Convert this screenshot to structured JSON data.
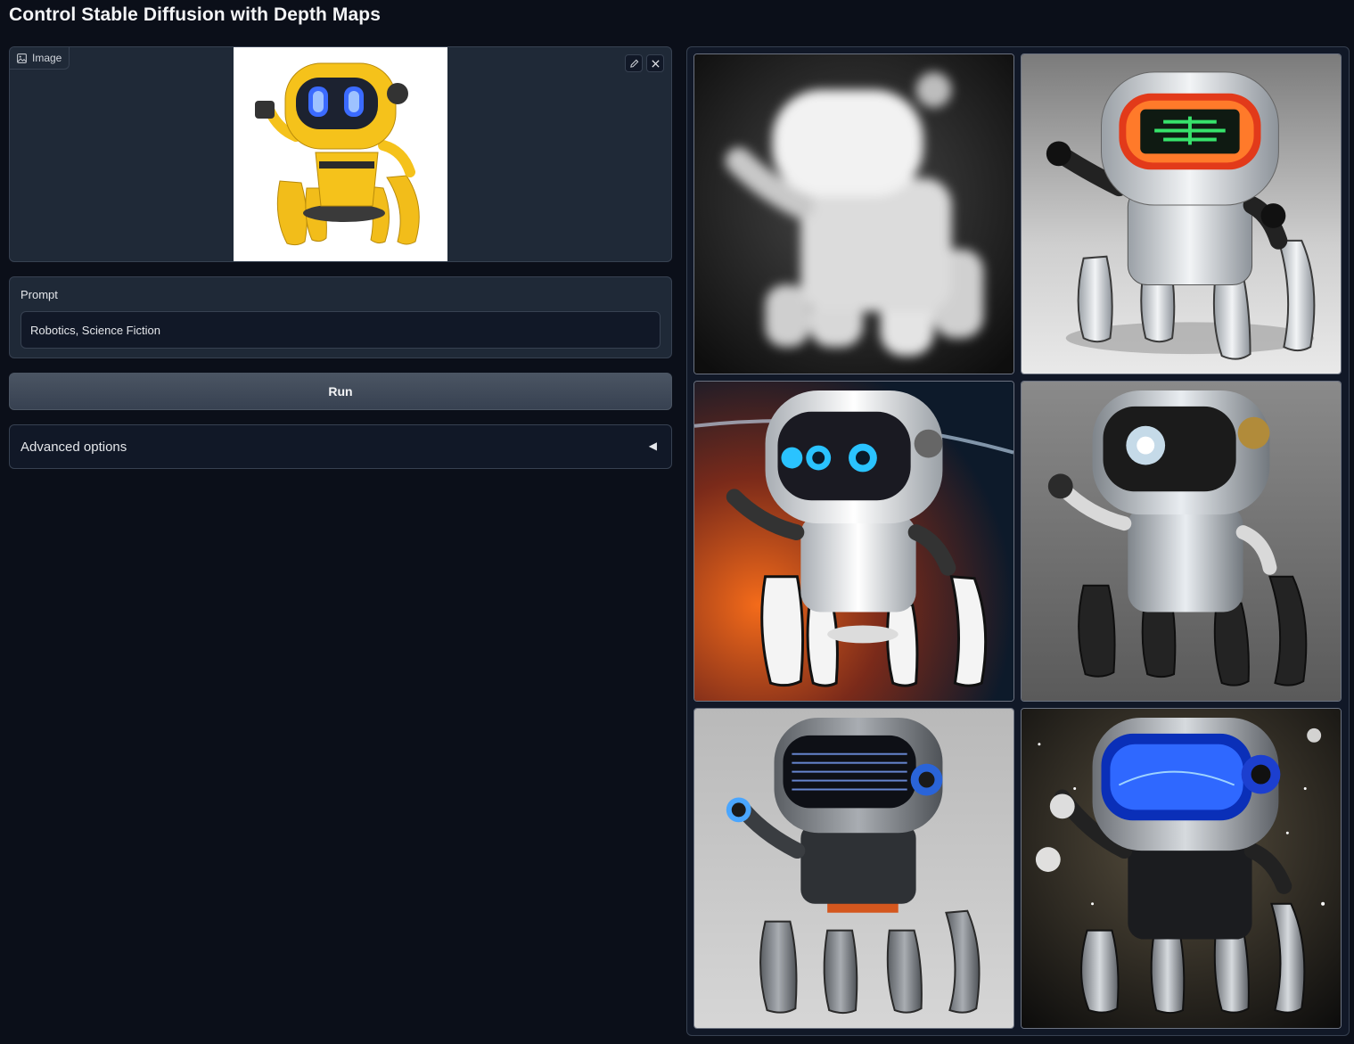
{
  "page": {
    "title": "Control Stable Diffusion with Depth Maps"
  },
  "image_input": {
    "label": "Image",
    "image_icon": "image-icon",
    "edit_icon": "pencil-icon",
    "clear_icon": "close-icon"
  },
  "prompt": {
    "label": "Prompt",
    "value": "Robotics, Science Fiction"
  },
  "run_button": {
    "label": "Run"
  },
  "advanced": {
    "label": "Advanced options",
    "arrow": "◀",
    "collapsed": true
  },
  "gallery": {
    "items": [
      {
        "kind": "depth-map"
      },
      {
        "kind": "generated-robot",
        "palette": "silver-red-visor"
      },
      {
        "kind": "generated-robot",
        "palette": "silver-space-orange"
      },
      {
        "kind": "generated-robot",
        "palette": "chrome-grey"
      },
      {
        "kind": "generated-robot",
        "palette": "dark-grey-led-visor"
      },
      {
        "kind": "generated-robot",
        "palette": "black-blue-visor-stars"
      }
    ]
  },
  "colors": {
    "background": "#0b0f19",
    "panel": "#1f2937",
    "border": "#374151",
    "robot_yellow": "#f5c21b"
  }
}
